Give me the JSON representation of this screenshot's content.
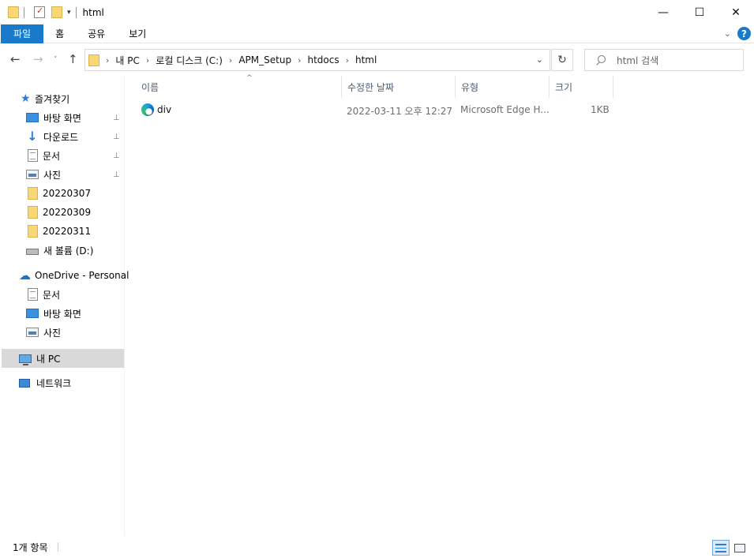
{
  "window": {
    "title": "html",
    "min_symbol": "—",
    "max_symbol": "☐",
    "close_symbol": "✕"
  },
  "ribbon": {
    "tabs": [
      "파일",
      "홈",
      "공유",
      "보기"
    ],
    "help": "?"
  },
  "nav": {
    "back": "←",
    "forward": "→",
    "recent": "˅",
    "up": "↑"
  },
  "address": {
    "crumbs": [
      "내 PC",
      "로컬 디스크 (C:)",
      "APM_Setup",
      "htdocs",
      "html"
    ],
    "separator": "›",
    "dropdown": "⌄",
    "refresh": "↻"
  },
  "search": {
    "placeholder": "html 검색"
  },
  "sidebar": {
    "quick_access": "즐겨찾기",
    "quick_items": [
      "바탕 화면",
      "다운로드",
      "문서",
      "사진",
      "20220307",
      "20220309",
      "20220311",
      "새 볼륨 (D:)"
    ],
    "onedrive": "OneDrive - Personal",
    "onedrive_items": [
      "문서",
      "바탕 화면",
      "사진"
    ],
    "this_pc": "내 PC",
    "network": "네트워크"
  },
  "columns": {
    "name": "이름",
    "modified": "수정한 날짜",
    "type": "유형",
    "size": "크기"
  },
  "files": [
    {
      "name": "div",
      "modified": "2022-03-11 오후 12:27",
      "type": "Microsoft Edge H...",
      "size": "1KB"
    }
  ],
  "status": {
    "count": "1개 항목"
  },
  "icons": {
    "pin": "📌"
  }
}
